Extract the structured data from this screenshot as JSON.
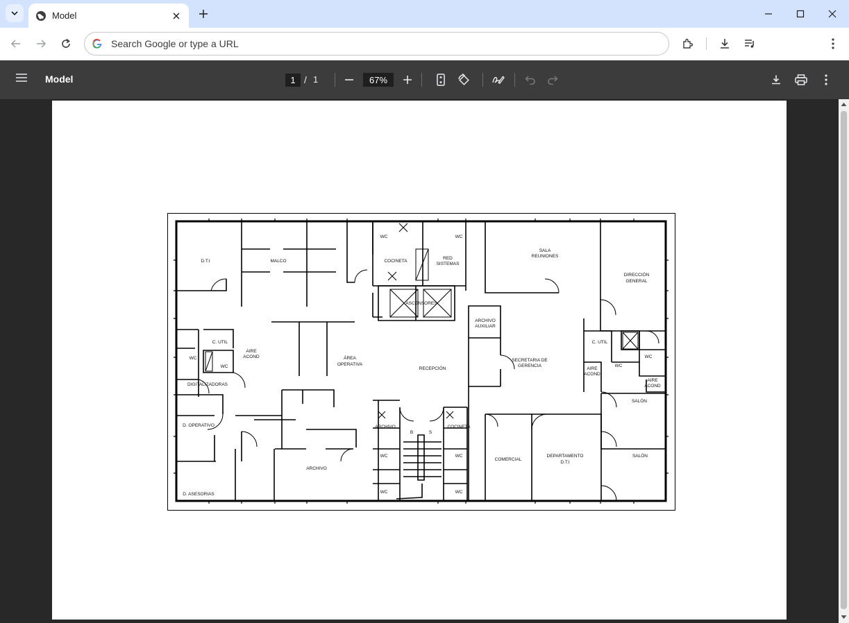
{
  "browser": {
    "tab_title": "Model",
    "omnibox_placeholder": "Search Google or type a URL"
  },
  "pdf": {
    "title": "Model",
    "current_page": "1",
    "page_separator": "/",
    "total_pages": "1",
    "zoom": "67%"
  },
  "floorplan": {
    "rooms": {
      "dti": "D.T.I",
      "malco": "MALCO",
      "wc_top_left": "WC",
      "cocineta_top": "COCINETA",
      "red_sistemas_1": "RED",
      "red_sistemas_2": "SISTEMAS",
      "wc_top_right": "WC",
      "sala_reuniones_1": "SALA",
      "sala_reuniones_2": "REUNIONES",
      "direccion_general_1": "DIRECCIÓN",
      "direccion_general_2": "GENERAL",
      "ascensores": "ASCENSORES",
      "archivo_auxiliar_1": "ARCHIVO",
      "archivo_auxiliar_2": "AUXILIAR",
      "c_util_left": "C. UTIL",
      "c_util_right": "C. UTIL",
      "wc_left": "WC",
      "wc_left_inner": "WC",
      "aire_acond_left_1": "AIRE",
      "aire_acond_left_2": "ACOND",
      "area_operativa_1": "ÁREA",
      "area_operativa_2": "OPERATIVA",
      "recepcion": "RECEPCIÓN",
      "secretaria_1": "SECRETARIA DE",
      "secretaria_2": "GERENCIA",
      "wc_right": "WC",
      "wc_right_inner": "WC",
      "aire_acond_mid_1": "AIRE",
      "aire_acond_mid_2": "ACOND",
      "aire_acond_right_1": "AIRE",
      "aire_acond_right_2": "ACOND",
      "digitalizadoras": "DIGITALIZADORAS",
      "salon_right_top": "SALÓN",
      "d_operativo": "D. OPERATIVO",
      "archivo_core": "ARCHIVO",
      "cocineta_bottom": "COCINETA",
      "stair_b": "B",
      "stair_s": "S",
      "wc_bottom_left_1": "WC",
      "wc_bottom_right_1": "WC",
      "archivo_bottom": "ARCHIVO",
      "comercial": "COMERCIAL",
      "depto_dti_1": "DEPARTAMENTO",
      "depto_dti_2": "D.T.I",
      "salon_right_bottom": "SALÓN",
      "d_asesorias": "D. ASESORIAS",
      "wc_bottom_left_2": "WC",
      "wc_bottom_right_2": "WC"
    }
  },
  "icons": {
    "tab_search": "chevron-down-icon",
    "favicon": "globe-icon",
    "close_tab": "close-icon",
    "new_tab": "plus-icon",
    "back": "arrow-left-icon",
    "forward": "arrow-right-icon",
    "reload": "reload-icon",
    "google": "google-g-icon",
    "extensions": "puzzle-icon",
    "downloads": "download-icon",
    "reading_list": "media-queue-icon",
    "chrome_menu": "kebab-icon",
    "pdf_menu": "hamburger-icon",
    "zoom_out": "minus-icon",
    "zoom_in": "plus-icon",
    "fit_page": "fit-page-icon",
    "rotate": "rotate-icon",
    "annotate": "pen-icon",
    "undo": "undo-icon",
    "redo": "redo-icon",
    "pdf_download": "download-icon",
    "print": "printer-icon",
    "pdf_more": "kebab-icon"
  },
  "colors": {
    "tabstrip": "#d3e3fd",
    "pdf_toolbar": "#3c3c3c",
    "viewer_bg": "#282828",
    "page": "#ffffff"
  }
}
